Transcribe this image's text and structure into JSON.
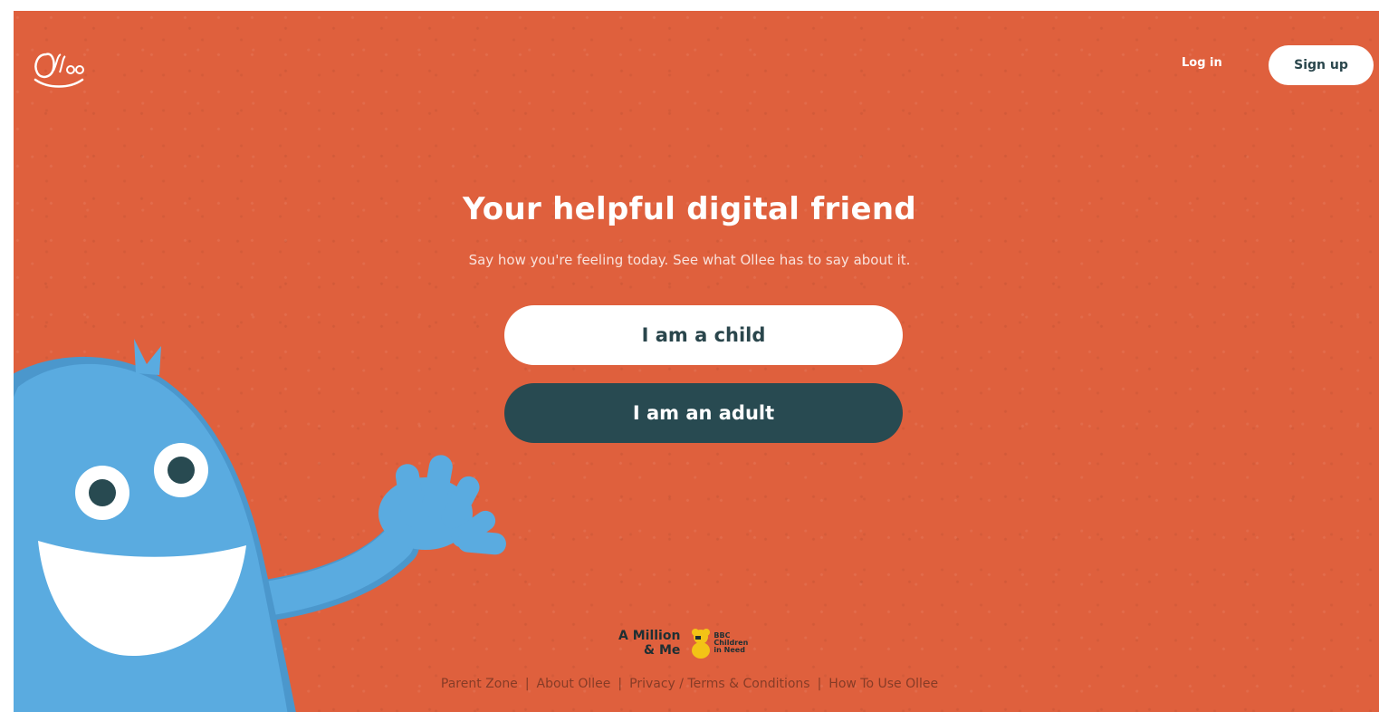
{
  "header": {
    "logo_alt": "Ollee",
    "login_label": "Log in",
    "signup_label": "Sign up"
  },
  "hero": {
    "title": "Your helpful digital friend",
    "subtitle": "Say how you're feeling today. See what Ollee has to say about it.",
    "child_button": "I am a child",
    "adult_button": "I am an adult"
  },
  "partners": {
    "amillion_line1": "A Million",
    "amillion_line2": "& Me",
    "cin_line1": "BBC",
    "cin_line2": "Children",
    "cin_line3": "in Need"
  },
  "footer": {
    "links": [
      "Parent Zone",
      "About Ollee",
      "Privacy / Terms & Conditions",
      "How To Use Ollee"
    ],
    "separator": "|"
  },
  "colors": {
    "background": "#df603d",
    "dark_teal": "#284a51",
    "mascot_blue": "#5aabe0",
    "white": "#ffffff"
  }
}
